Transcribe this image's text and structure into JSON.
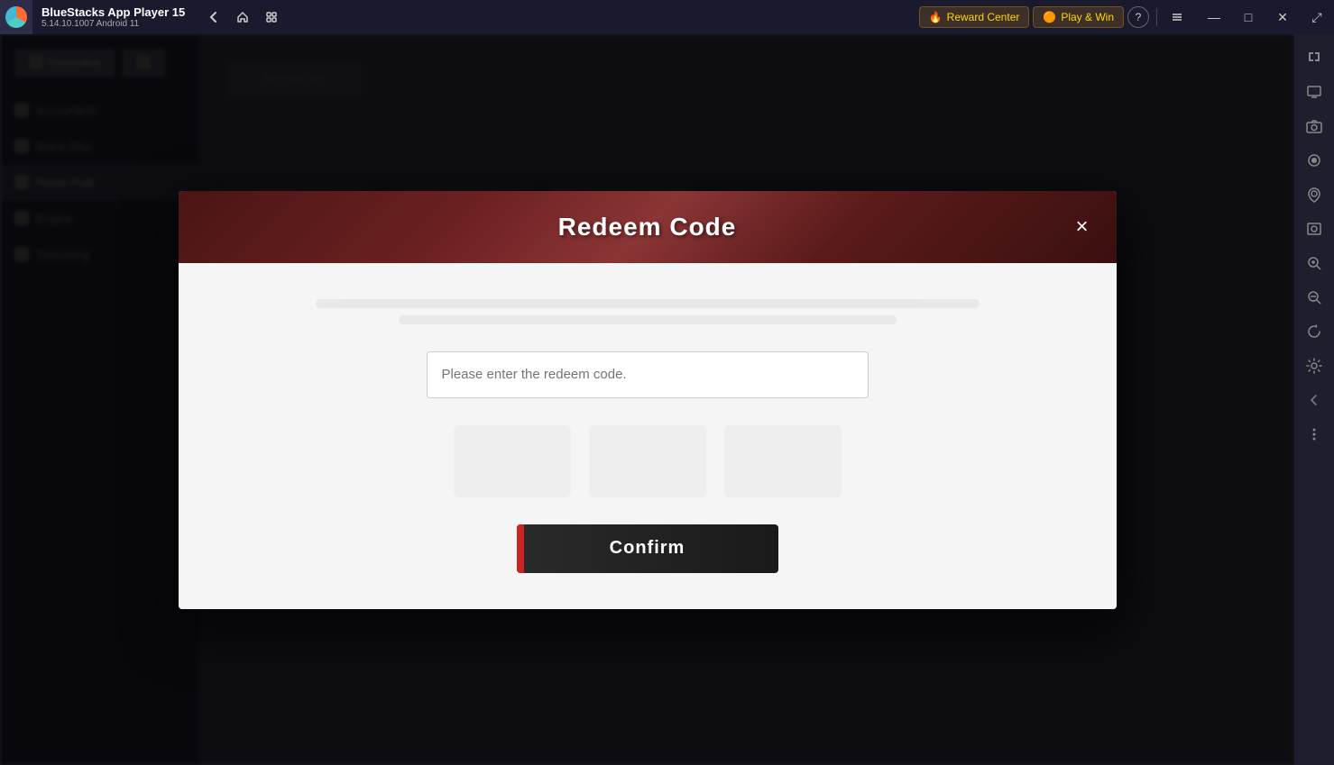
{
  "titleBar": {
    "appName": "BlueStacks App Player 15",
    "version": "5.14.10.1007  Android 11",
    "rewardCenter": "Reward Center",
    "playWin": "Play & Win",
    "backBtn": "‹",
    "homeBtn": "⌂",
    "multiBtn": "❑",
    "helpBtn": "?",
    "minimizeBtn": "—",
    "maximizeBtn": "□",
    "closeBtn": "✕",
    "expandBtn": "⤢"
  },
  "modal": {
    "title": "Redeem Code",
    "closeBtnLabel": "×",
    "inputPlaceholder": "Please enter the redeem code.",
    "confirmLabel": "Confirm"
  },
  "sidebar": {
    "icons": [
      {
        "name": "expand-icon",
        "symbol": "⤢"
      },
      {
        "name": "screen-icon",
        "symbol": "🖥"
      },
      {
        "name": "camera-icon",
        "symbol": "📷"
      },
      {
        "name": "record-icon",
        "symbol": "⏺"
      },
      {
        "name": "location-icon",
        "symbol": "⊙"
      },
      {
        "name": "screenshot-icon",
        "symbol": "📸"
      },
      {
        "name": "zoom-in-icon",
        "symbol": "↑"
      },
      {
        "name": "zoom-out-icon",
        "symbol": "↓"
      },
      {
        "name": "refresh-icon",
        "symbol": "↻"
      },
      {
        "name": "settings-icon",
        "symbol": "⚙"
      },
      {
        "name": "arrow-icon",
        "symbol": "←"
      },
      {
        "name": "more-icon",
        "symbol": "…"
      }
    ]
  },
  "background": {
    "menuItems": [
      {
        "label": "Accountinfo",
        "active": false
      },
      {
        "label": "Maint Disp",
        "active": false
      },
      {
        "label": "Home Rule",
        "active": true
      },
      {
        "label": "Engine",
        "active": false
      },
      {
        "label": "Streaming",
        "active": false
      }
    ]
  }
}
